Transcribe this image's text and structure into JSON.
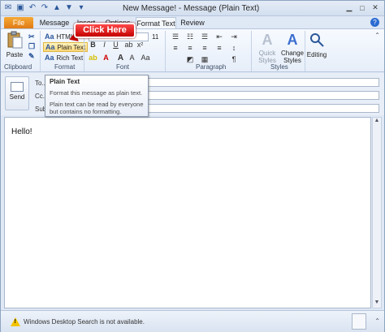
{
  "window": {
    "title": "New Message! - Message (Plain Text)"
  },
  "tabs": [
    {
      "label": "File"
    },
    {
      "label": "Message"
    },
    {
      "label": "Insert"
    },
    {
      "label": "Options"
    },
    {
      "label": "Format Text"
    },
    {
      "label": "Review"
    }
  ],
  "ribbon": {
    "clipboard": {
      "paste_label": "Paste",
      "group_label": "Clipboard"
    },
    "format": {
      "html_label": "HTML",
      "plain_label": "Plain Text",
      "rich_label": "Rich Text",
      "group_label": "Format"
    },
    "font": {
      "size_value": "11",
      "group_label": "Font",
      "bold": "B",
      "italic": "I",
      "underline": "U",
      "grow": "A",
      "shrink": "A",
      "clear": "Aa"
    },
    "paragraph": {
      "group_label": "Paragraph"
    },
    "styles": {
      "quick_styles_label": "Quick Styles",
      "change_styles_label": "Change Styles",
      "group_label": "Styles"
    },
    "editing": {
      "label": "Editing"
    }
  },
  "callout": {
    "text": "Click Here"
  },
  "tooltip": {
    "title": "Plain Text",
    "description": "Format this message as plain text.",
    "note": "Plain text can be read by everyone but contains no formatting."
  },
  "compose": {
    "send_label": "Send",
    "to_label": "To...",
    "cc_label": "Cc...",
    "subject_label": "Subject:",
    "to_value": "",
    "cc_value": "",
    "subject_value": ""
  },
  "body": {
    "text": "Hello!"
  },
  "status": {
    "text": "Windows Desktop Search is not available."
  },
  "colors": {
    "file_tab": "#e07b16",
    "callout": "#c40000",
    "warning": "#f5c400"
  }
}
